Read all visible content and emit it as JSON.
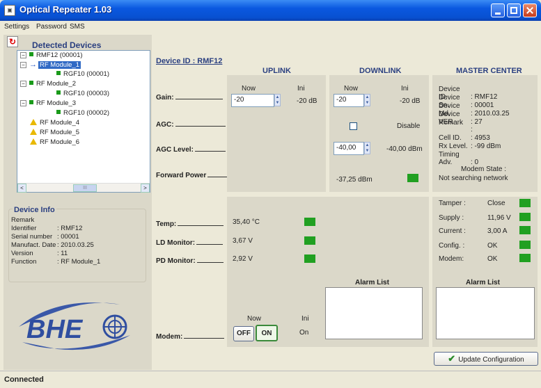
{
  "window": {
    "title": "Optical Repeater 1.03"
  },
  "menu": [
    "Settings",
    "Password",
    "SMS"
  ],
  "left": {
    "detected_title": "Detected Devices",
    "tree": [
      {
        "label": "RMF12 (00001)"
      },
      {
        "label": "RF Module_1"
      },
      {
        "label": "RGF10 (00001)"
      },
      {
        "label": "RF Module_2"
      },
      {
        "label": "RGF10 (00003)"
      },
      {
        "label": "RF Module_3"
      },
      {
        "label": "RGF10 (00002)"
      },
      {
        "label": "RF Module_4"
      },
      {
        "label": "RF Module_5"
      },
      {
        "label": "RF Module_6"
      }
    ],
    "scroll_mark": "III",
    "device_info": {
      "title": "Device Info",
      "rows": [
        {
          "k": "Remark",
          "v": ""
        },
        {
          "k": "Identifier",
          "v": ": RMF12"
        },
        {
          "k": "Serial number",
          "v": ": 00001"
        },
        {
          "k": "Manufact. Date",
          "v": ": 2010.03.25"
        },
        {
          "k": "Version",
          "v": ": 11"
        },
        {
          "k": "Function",
          "v": ": RF Module_1"
        }
      ]
    },
    "logo_text": "BHE"
  },
  "main": {
    "device_id": "Device ID : RMF12",
    "uplink": "UPLINK",
    "downlink": "DOWNLINK",
    "master": "MASTER CENTER",
    "labels": {
      "gain": "Gain:",
      "agc": "AGC:",
      "agc_level": "AGC Level:",
      "forward_power": "Forward Power",
      "temp": "Temp:",
      "ld": "LD Monitor:",
      "pd": "PD Monitor:",
      "modem": "Modem:"
    },
    "now": "Now",
    "ini": "Ini",
    "up_gain_now": "-20",
    "up_gain_ini": "-20  dB",
    "down_gain_now": "-20",
    "down_gain_ini": "-20  dB",
    "disable": "Disable",
    "agc_level_now": "-40,00",
    "agc_level_ini": "-40,00 dBm",
    "forward_power_val": "-37,25 dBm",
    "temp_val": "35,40 °C",
    "ld_val": "3,67 V",
    "pd_val": "2,92 V",
    "alarm_list": "Alarm List",
    "modem_off": "OFF",
    "modem_on": "ON",
    "modem_ini": "On"
  },
  "master_center": {
    "rows": [
      {
        "k": "Device ID.",
        "v": ": RMF12"
      },
      {
        "k": "Device Sn.",
        "v": ": 00001"
      },
      {
        "k": "Device Md.",
        "v": ": 2010.03.25"
      },
      {
        "k": "Device VER.",
        "v": ": 27"
      },
      {
        "k": "Remark",
        "v": ""
      },
      {
        "k": "",
        "v": ":"
      },
      {
        "k": "Cell ID.",
        "v": ": 4953"
      },
      {
        "k": "Rx Level.",
        "v": ": -99 dBm"
      },
      {
        "k": "Timing Adv.",
        "v": ": 0"
      }
    ],
    "modem_state_title": "Modem State :",
    "modem_state": "Not searching network",
    "status": [
      {
        "k": "Tamper :",
        "v": "Close"
      },
      {
        "k": "Supply :",
        "v": "11,96 V"
      },
      {
        "k": "Current :",
        "v": "3,00 A"
      },
      {
        "k": "Config. :",
        "v": "OK"
      },
      {
        "k": "Modem:",
        "v": "OK"
      }
    ],
    "alarm_list": "Alarm List",
    "update_button": "Update Configuration"
  },
  "status": {
    "text": "Connected"
  },
  "colors": {
    "led": "#21a021",
    "title_blue": "#2a3f80"
  }
}
